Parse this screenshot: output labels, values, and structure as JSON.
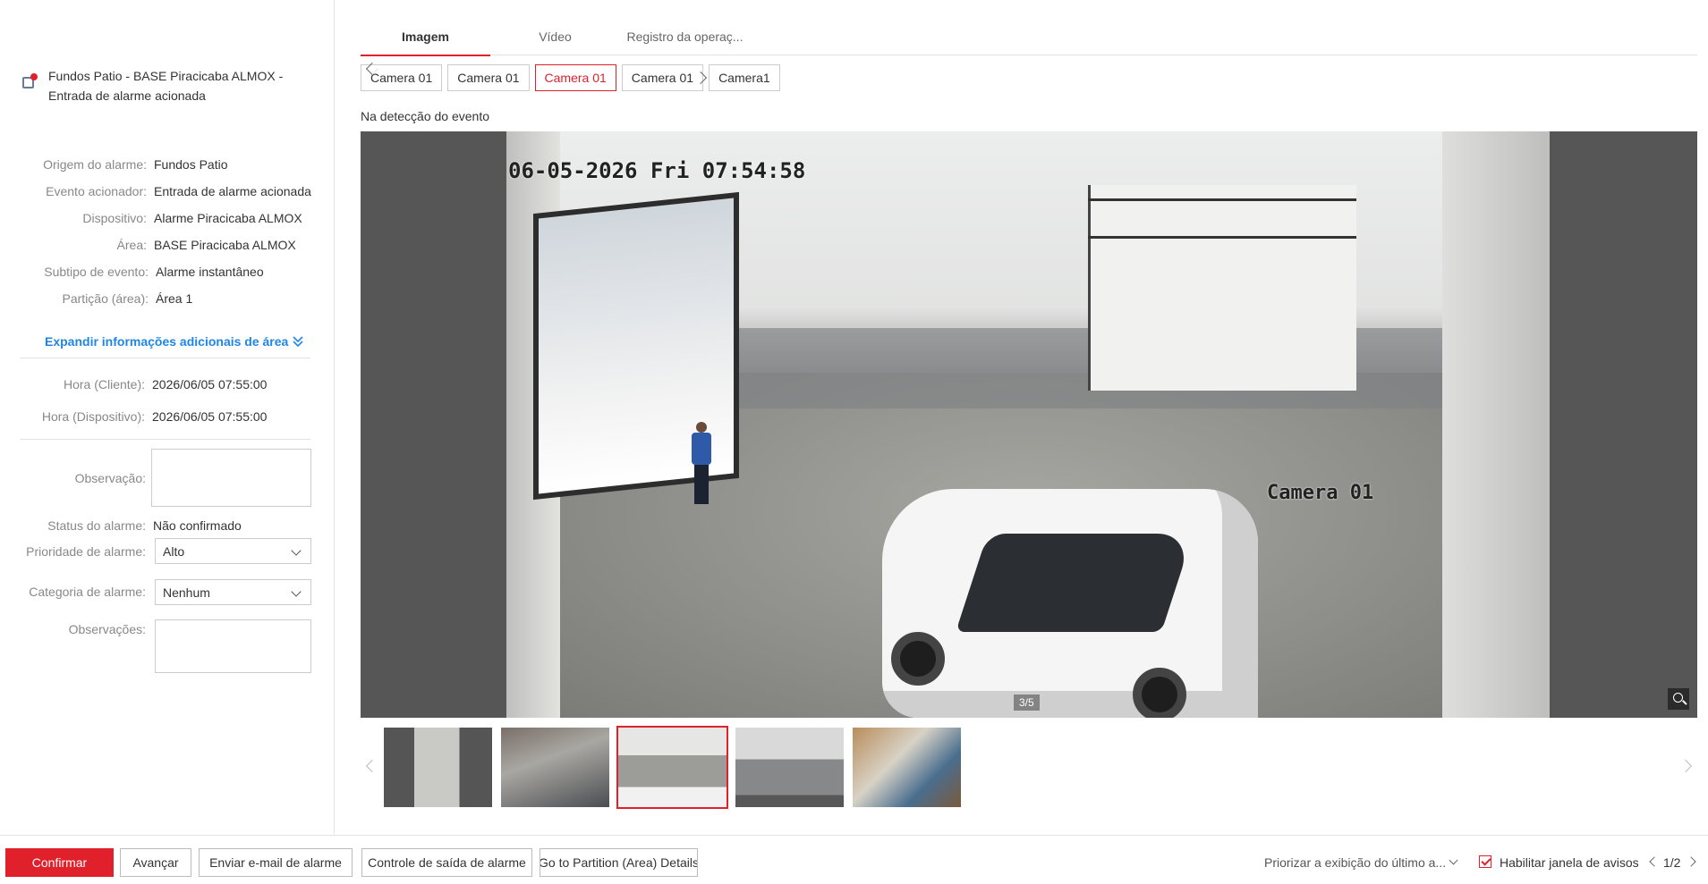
{
  "alarm": {
    "title_line1": "Fundos Patio - BASE Piracicaba ALMOX -",
    "title_line2": "Entrada de alarme acionada"
  },
  "details": [
    {
      "label": "Origem do alarme:",
      "value": "Fundos Patio"
    },
    {
      "label": "Evento acionador:",
      "value": "Entrada de alarme acionada"
    },
    {
      "label": "Dispositivo:",
      "value": "Alarme Piracicaba ALMOX"
    },
    {
      "label": "Área:",
      "value": "BASE Piracicaba ALMOX"
    },
    {
      "label": "Subtipo de evento:",
      "value": "Alarme instantâneo"
    },
    {
      "label": "Partição (área):",
      "value": "Área 1"
    }
  ],
  "expand_label": "Expandir informações adicionais de área",
  "times": [
    {
      "label": "Hora (Cliente):",
      "value": "2026/06/05 07:55:00"
    },
    {
      "label": "Hora (Dispositivo):",
      "value": "2026/06/05 07:55:00"
    }
  ],
  "form": {
    "observacao_label": "Observação:",
    "status_label": "Status do alarme:",
    "status_value": "Não confirmado",
    "priority_label": "Prioridade de alarme:",
    "priority_value": "Alto",
    "category_label": "Categoria de alarme:",
    "category_value": "Nenhum",
    "observacoes_label": "Observações:"
  },
  "tabs": [
    "Imagem",
    "Vídeo",
    "Registro da operaç..."
  ],
  "cameras": [
    "Camera 01",
    "Camera 01",
    "Camera 01",
    "Camera 01",
    "Camera1"
  ],
  "active_camera_index": 2,
  "event_label": "Na detecção do evento",
  "viewer": {
    "osd_timestamp": "06-05-2026 Fri 07:54:58",
    "osd_camera": "Camera 01",
    "counter": "3/5",
    "zoom_icon": "zoom-in-icon"
  },
  "thumbnails_count": 5,
  "active_thumbnail_index": 2,
  "footer": {
    "confirm": "Confirmar",
    "advance": "Avançar",
    "email": "Enviar e-mail de alarme",
    "output": "Controle de saída de alarme",
    "partition": "Go to Partition (Area) Details",
    "prioritize": "Priorizar a exibição do último a...",
    "enable_popup": "Habilitar janela de avisos",
    "pagination": "1/2"
  },
  "colors": {
    "accent": "#e0212b",
    "link": "#1f86e6"
  }
}
